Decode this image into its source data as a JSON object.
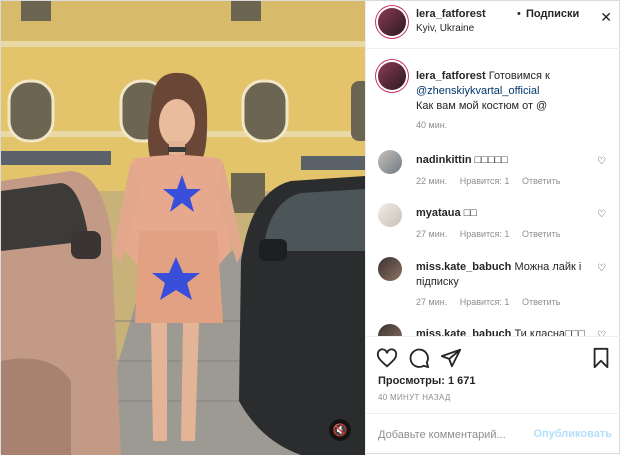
{
  "header": {
    "username": "lera_fatforest",
    "dot": "•",
    "follow_label": "Подписки",
    "location": "Kyiv, Ukraine",
    "close_icon": "close-icon"
  },
  "caption": {
    "username": "lera_fatforest",
    "text_before": "Готовимся к",
    "mention": "@zhenskiykvartal_official",
    "text_after": "Как вам мой костюм от @",
    "time": "40 мин."
  },
  "comments": [
    {
      "username": "nadinkittin",
      "text": "□□□□□",
      "time": "22 мин.",
      "likes": "Нравится: 1",
      "reply": "Ответить"
    },
    {
      "username": "myataua",
      "text": "□□",
      "time": "27 мин.",
      "likes": "Нравится: 1",
      "reply": "Ответить"
    },
    {
      "username": "miss.kate_babuch",
      "text": "Можна лайк і підписку",
      "time": "27 мин.",
      "likes": "Нравится: 1",
      "reply": "Ответить"
    },
    {
      "username": "miss.kate_babuch",
      "text": "Ти класна□□□",
      "time": "",
      "likes": "",
      "reply": ""
    }
  ],
  "stats": {
    "views": "Просмотры: 1 671",
    "ago": "40 МИНУТ НАЗАД"
  },
  "add_comment": {
    "placeholder": "Добавьте комментарий...",
    "post_label": "Опубликовать"
  },
  "icons": {
    "like": "heart-icon",
    "comment": "comment-icon",
    "share": "send-icon",
    "save": "bookmark-icon",
    "mute": "speaker-muted-icon"
  },
  "colors": {
    "link": "#00376b",
    "muted": "#8e8e8e",
    "post_disabled": "#b2dffc"
  }
}
